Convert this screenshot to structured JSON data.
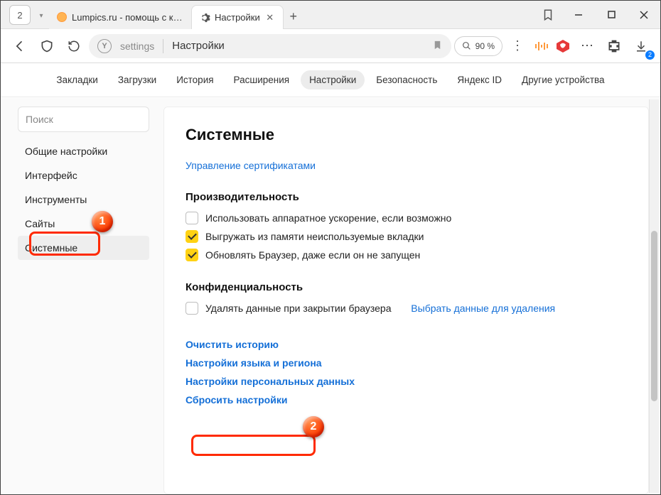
{
  "window": {
    "tab_count": "2",
    "tabs": [
      {
        "title": "Lumpics.ru - помощь с ком",
        "active": false
      },
      {
        "title": "Настройки",
        "active": true
      }
    ],
    "downloads_badge": "2"
  },
  "toolbar": {
    "address_domain": "settings",
    "address_title": "Настройки",
    "zoom_label": "90 %"
  },
  "settings_nav": [
    "Закладки",
    "Загрузки",
    "История",
    "Расширения",
    "Настройки",
    "Безопасность",
    "Яндекс ID",
    "Другие устройства"
  ],
  "settings_nav_active_index": 4,
  "sidebar": {
    "search_placeholder": "Поиск",
    "items": [
      "Общие настройки",
      "Интерфейс",
      "Инструменты",
      "Сайты",
      "Системные"
    ],
    "active_index": 4
  },
  "main": {
    "title": "Системные",
    "cert_link": "Управление сертификатами",
    "perf_heading": "Производительность",
    "perf_items": [
      {
        "label": "Использовать аппаратное ускорение, если возможно",
        "checked": false
      },
      {
        "label": "Выгружать из памяти неиспользуемые вкладки",
        "checked": true
      },
      {
        "label": "Обновлять Браузер, даже если он не запущен",
        "checked": true
      }
    ],
    "privacy_heading": "Конфиденциальность",
    "privacy_item_label": "Удалять данные при закрытии браузера",
    "privacy_item_checked": false,
    "privacy_choose_link": "Выбрать данные для удаления",
    "links": [
      "Очистить историю",
      "Настройки языка и региона",
      "Настройки персональных данных",
      "Сбросить настройки"
    ]
  },
  "annotations": {
    "one": "1",
    "two": "2"
  }
}
